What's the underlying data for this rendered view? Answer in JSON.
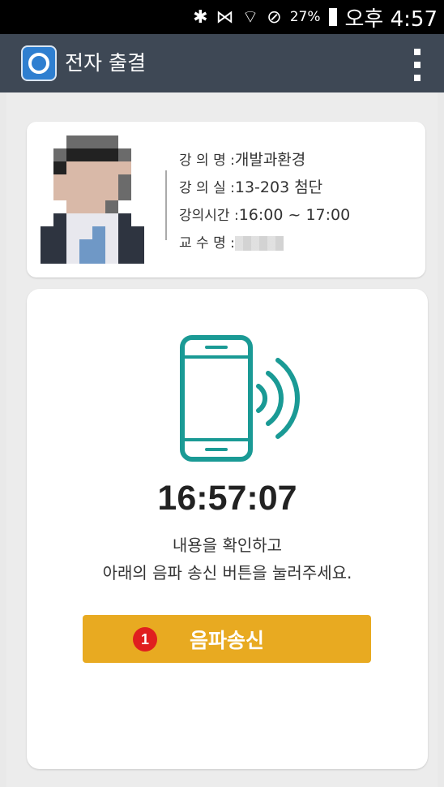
{
  "status_bar": {
    "icons": [
      "bluetooth-icon",
      "vibrate-off-icon",
      "wifi-icon",
      "blocked-icon"
    ],
    "battery_percent": "27%",
    "time": "오후 4:57"
  },
  "app_bar": {
    "title": "전자 출결",
    "icon": "app-power-icon",
    "menu_icon": "overflow-menu-icon"
  },
  "lecture": {
    "name_label": "강 의 명 :",
    "name_value": "개발과환경",
    "room_label": "강 의 실 :",
    "room_value": "13-203 첨단",
    "time_label": "강의시간 :",
    "time_value": "16:00 ~ 17:00",
    "professor_label": "교 수 명 :"
  },
  "attendance": {
    "clock": "16:57:07",
    "message_line1": "내용을 확인하고",
    "message_line2": "아래의 음파 송신 버튼을 눌러주세요.",
    "send_button": "음파송신",
    "badge": "1",
    "accent_color": "#1a9a95",
    "button_color": "#e8aa21"
  }
}
